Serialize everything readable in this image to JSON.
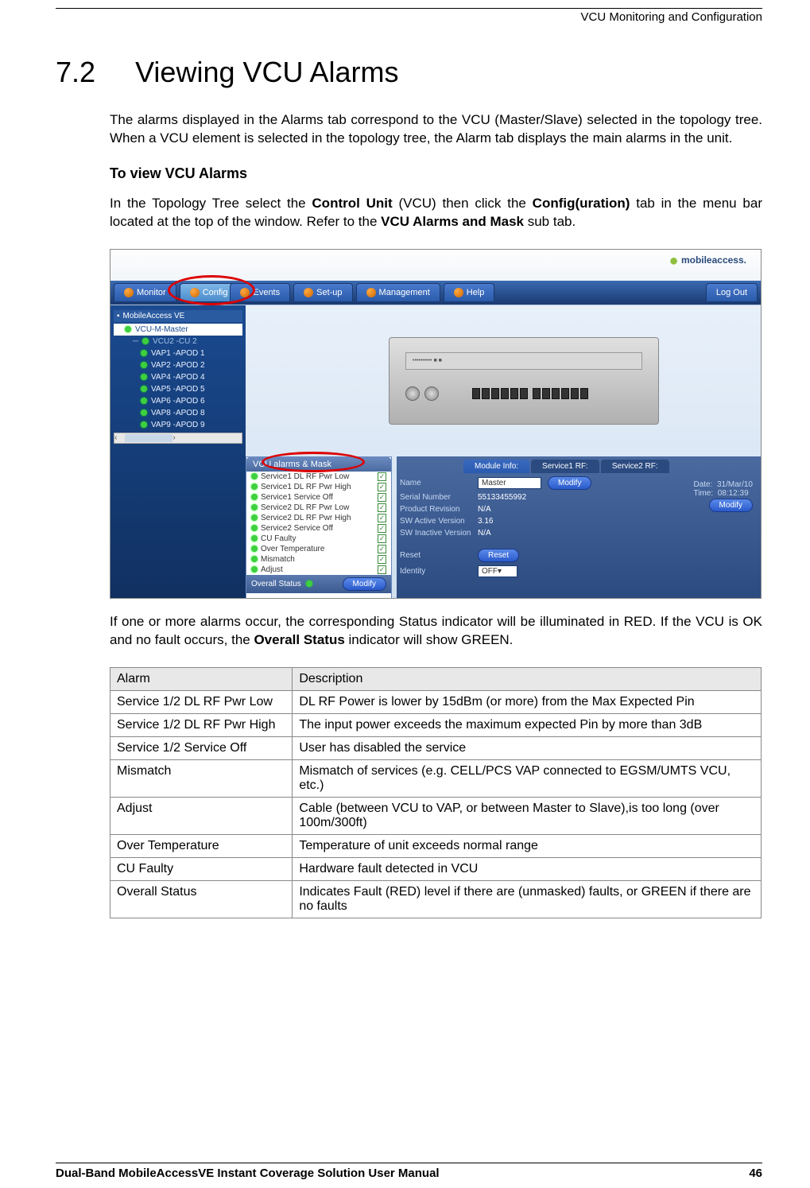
{
  "header": {
    "right_title": "VCU Monitoring and Configuration"
  },
  "section": {
    "number": "7.2",
    "title": "Viewing VCU Alarms"
  },
  "paragraphs": {
    "intro": "The alarms displayed in the Alarms tab correspond to the VCU (Master/Slave) selected in the topology tree. When a VCU element is selected in the topology tree, the Alarm tab displays the main alarms in the unit.",
    "sub_heading": "To view VCU Alarms",
    "instruction_pre": "In the Topology Tree select the ",
    "instruction_b1": "Control Unit",
    "instruction_mid1": " (VCU) then click the ",
    "instruction_b2": "Config(uration)",
    "instruction_mid2": " tab in the menu bar located at the top of the window.  Refer to the ",
    "instruction_b3": "VCU Alarms and Mask",
    "instruction_end": " sub tab.",
    "post_shot_pre": "If one or more alarms occur, the corresponding Status indicator will be illuminated in RED. If the VCU is OK and no fault occurs, the ",
    "post_shot_b": "Overall Status",
    "post_shot_end": " indicator will show GREEN."
  },
  "app": {
    "logo_text": "mobileaccess",
    "nav": {
      "monitor": "Monitor",
      "config": "Config",
      "events": "Events",
      "setup": "Set-up",
      "management": "Management",
      "help": "Help",
      "logout": "Log Out"
    },
    "tree": {
      "root": "MobileAccess VE",
      "master": "VCU-M-Master",
      "child": "VCU2 -CU 2",
      "leaves": [
        "VAP1 -APOD 1",
        "VAP2 -APOD 2",
        "VAP4 -APOD 4",
        "VAP5 -APOD 5",
        "VAP6 -APOD 6",
        "VAP8 -APOD 8",
        "VAP9 -APOD 9"
      ]
    },
    "alarms_panel": {
      "title": "VCU alarms & Mask",
      "items": [
        "Service1 DL RF Pwr Low",
        "Service1 DL RF Pwr High",
        "Service1 Service Off",
        "Service2 DL RF Pwr Low",
        "Service2 DL RF Pwr High",
        "Service2 Service Off",
        "CU Faulty",
        "Over Temperature",
        "Mismatch",
        "Adjust"
      ],
      "overall": "Overall Status",
      "modify": "Modify"
    },
    "info_panel": {
      "tabs": {
        "module": "Module Info:",
        "s1": "Service1 RF:",
        "s2": "Service2 RF:"
      },
      "name_label": "Name",
      "name_value": "Master",
      "sn_label": "Serial Number",
      "sn_value": "55133455992",
      "rev_label": "Product Revision",
      "rev_value": "N/A",
      "swa_label": "SW Active Version",
      "swa_value": "3.16",
      "swi_label": "SW Inactive Version",
      "swi_value": "N/A",
      "reset_label": "Reset",
      "reset_btn": "Reset",
      "identity_label": "Identity",
      "identity_value": "OFF",
      "date_label": "Date:",
      "date_value": "31/Mar/10",
      "time_label": "Time:",
      "time_value": "08:12:39",
      "modify": "Modify"
    }
  },
  "table": {
    "h1": "Alarm",
    "h2": "Description",
    "rows": [
      {
        "a": "Service 1/2 DL RF Pwr Low",
        "d": "DL RF Power is lower by 15dBm (or more) from the Max Expected Pin"
      },
      {
        "a": "Service 1/2 DL RF Pwr High",
        "d": "The input power exceeds the maximum expected Pin by more than 3dB"
      },
      {
        "a": "Service 1/2 Service Off",
        "d": "User has disabled the service"
      },
      {
        "a": "Mismatch",
        "d": "Mismatch of services (e.g. CELL/PCS VAP connected to EGSM/UMTS VCU, etc.)"
      },
      {
        "a": "Adjust",
        "d": "Cable (between VCU to VAP, or between Master to Slave),is too long (over 100m/300ft)"
      },
      {
        "a": "Over Temperature",
        "d": "Temperature of unit exceeds normal range"
      },
      {
        "a": "CU Faulty",
        "d": "Hardware fault detected in VCU"
      },
      {
        "a": "Overall Status",
        "d": "Indicates Fault (RED) level if there are (unmasked) faults, or GREEN if there are no faults"
      }
    ]
  },
  "footer": {
    "left": "Dual-Band MobileAccessVE Instant Coverage Solution User Manual",
    "right": "46"
  }
}
